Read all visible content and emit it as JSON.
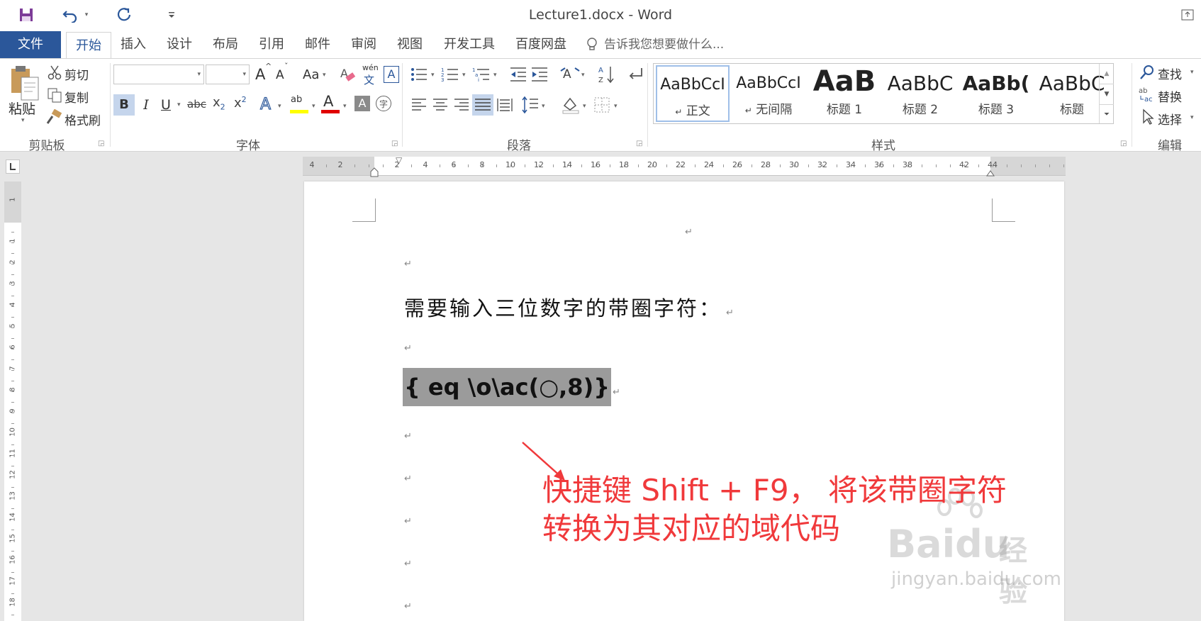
{
  "window": {
    "title": "Lecture1.docx - Word"
  },
  "tabs": {
    "file": "文件",
    "home": "开始",
    "insert": "插入",
    "design": "设计",
    "layout": "布局",
    "references": "引用",
    "mailings": "邮件",
    "review": "审阅",
    "view": "视图",
    "developer": "开发工具",
    "baidu": "百度网盘",
    "tell_me": "告诉我您想要做什么..."
  },
  "clipboard": {
    "paste": "粘贴",
    "cut": "剪切",
    "copy": "复制",
    "format_painter": "格式刷",
    "label": "剪贴板"
  },
  "font": {
    "label": "字体",
    "bold": "B",
    "italic": "I",
    "underline": "U",
    "strike": "abc",
    "grow": "A",
    "shrink": "A",
    "case": "Aa",
    "phonetic_top": "wén",
    "phonetic_bottom": "文",
    "border_char": "A",
    "text_effects": "A",
    "highlight": "ab",
    "font_color": "A",
    "shade": "A",
    "enclose": "字"
  },
  "paragraph": {
    "label": "段落"
  },
  "styles": {
    "label": "样式",
    "items": [
      {
        "sample": "AaBbCcI",
        "name": "正文"
      },
      {
        "sample": "AaBbCcI",
        "name": "无间隔"
      },
      {
        "sample": "AaB",
        "name": "标题 1"
      },
      {
        "sample": "AaBbC",
        "name": "标题 2"
      },
      {
        "sample": "AaBb(",
        "name": "标题 3"
      },
      {
        "sample": "AaBbC",
        "name": "标题"
      }
    ]
  },
  "editing": {
    "find": "查找",
    "replace": "替换",
    "select": "选择",
    "label": "编辑"
  },
  "ruler": {
    "h_ticks": [
      "4",
      "2",
      "2",
      "4",
      "6",
      "8",
      "10",
      "12",
      "14",
      "16",
      "18",
      "20",
      "22",
      "24",
      "26",
      "28",
      "30",
      "32",
      "34",
      "36",
      "38",
      "42",
      "44"
    ],
    "v_ticks": [
      "1",
      "1",
      "2",
      "3",
      "4",
      "5",
      "6",
      "7",
      "8",
      "9",
      "10",
      "11",
      "12",
      "13",
      "14",
      "15",
      "16",
      "17",
      "18"
    ]
  },
  "document": {
    "para_mark": "↵",
    "line1": "需要输入三位数字的带圈字符：",
    "field_code": "{ eq \\o\\ac(○,8)}"
  },
  "annotation": {
    "line1": "快捷键 Shift + F9， 将该带圈字符",
    "line2": "转换为其对应的域代码",
    "color": "#f0393b"
  },
  "watermark": {
    "brand": "Baidu",
    "suffix": "经验",
    "url": "jingyan.baidu.com"
  }
}
